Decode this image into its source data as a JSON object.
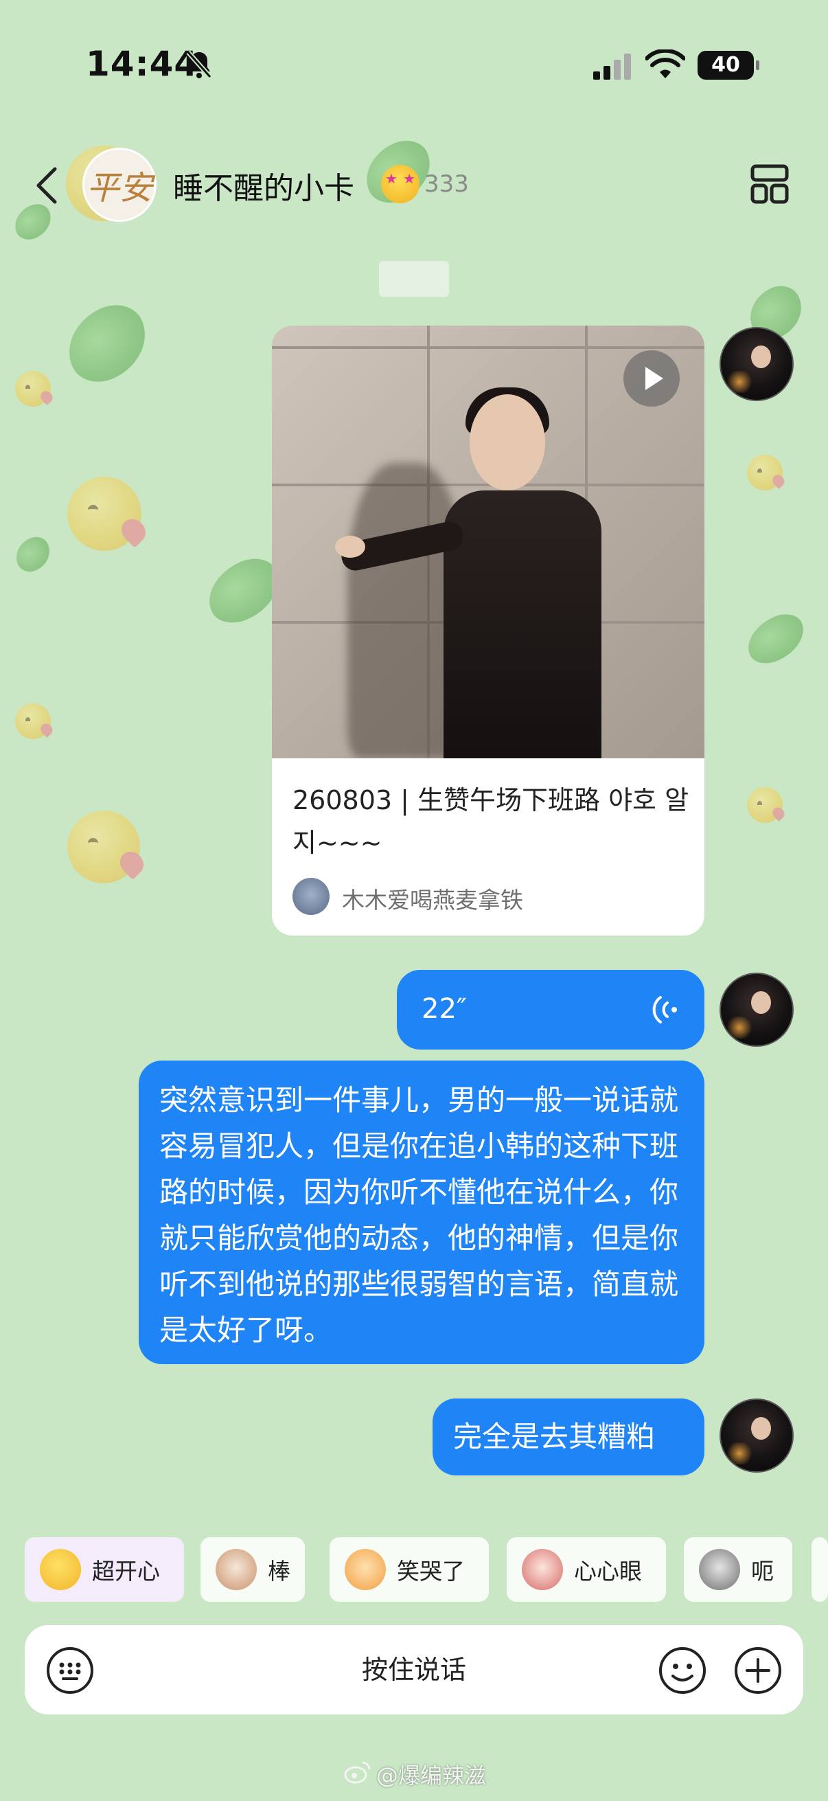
{
  "status_bar": {
    "time": "14:44",
    "battery": "40"
  },
  "header": {
    "title": "睡不醒的小卡",
    "count": "333",
    "avatar_text": "平安"
  },
  "video_card": {
    "title": "260803 | 生赞午场下班路 야호 알지~~~",
    "author": "木木爱喝燕麦拿铁"
  },
  "messages": {
    "voice_duration": "22″",
    "long_text": "突然意识到一件事儿，男的一般一说话就容易冒犯人，但是你在追小韩的这种下班路的时候，因为你听不懂他在说什么，你就只能欣赏他的动态，他的神情，但是你听不到他说的那些很弱智的言语，简直就是太好了呀。",
    "short_text": "完全是去其糟粕"
  },
  "reactions": [
    {
      "label": "超开心",
      "icon": "star-eyes-emoji-icon"
    },
    {
      "label": "棒",
      "icon": "cat-thumbs-up-icon"
    },
    {
      "label": "笑哭了",
      "icon": "cat-tears-of-joy-icon"
    },
    {
      "label": "心心眼",
      "icon": "cat-heart-eyes-icon"
    },
    {
      "label": "呃",
      "icon": "cat-awkward-icon"
    }
  ],
  "input_bar": {
    "hold_to_talk": "按住说话"
  },
  "watermark": "@爆编辣滋",
  "colors": {
    "background": "#c9e6c5",
    "bubble": "#1f84f5",
    "card": "#ffffff"
  }
}
